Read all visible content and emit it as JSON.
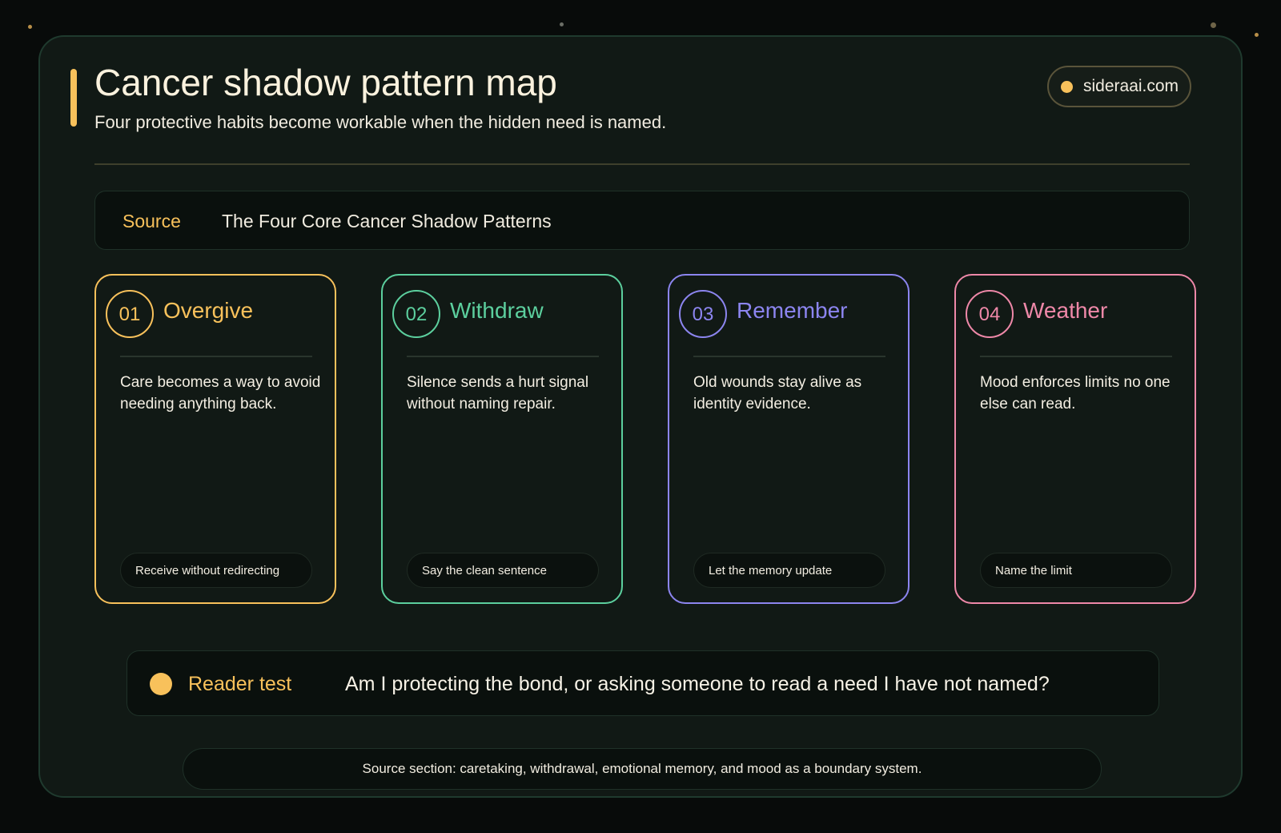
{
  "header": {
    "title": "Cancer shadow pattern map",
    "subtitle": "Four protective habits become workable when the hidden need is named.",
    "brand": "sideraai.com"
  },
  "source": {
    "label": "Source",
    "value": "The Four Core Cancer Shadow Patterns"
  },
  "cards": [
    {
      "number": "01",
      "title": "Overgive",
      "description": "Care becomes a way to avoid needing anything back.",
      "action": "Receive without redirecting",
      "color": "#f8c15b"
    },
    {
      "number": "02",
      "title": "Withdraw",
      "description": "Silence sends a hurt signal without naming repair.",
      "action": "Say the clean sentence",
      "color": "#5ccf9e"
    },
    {
      "number": "03",
      "title": "Remember",
      "description": "Old wounds stay alive as identity evidence.",
      "action": "Let the memory update",
      "color": "#8c85ef"
    },
    {
      "number": "04",
      "title": "Weather",
      "description": "Mood enforces limits no one else can read.",
      "action": "Name the limit",
      "color": "#ee88a8"
    }
  ],
  "reader_test": {
    "label": "Reader test",
    "question": "Am I protecting the bond, or asking someone to read a need I have not named?"
  },
  "footer": {
    "text": "Source section: caretaking, withdrawal, emotional memory, and mood as a boundary system."
  },
  "colors": {
    "accent": "#f8c15b",
    "background": "#080b0a",
    "panel": "#111915"
  }
}
